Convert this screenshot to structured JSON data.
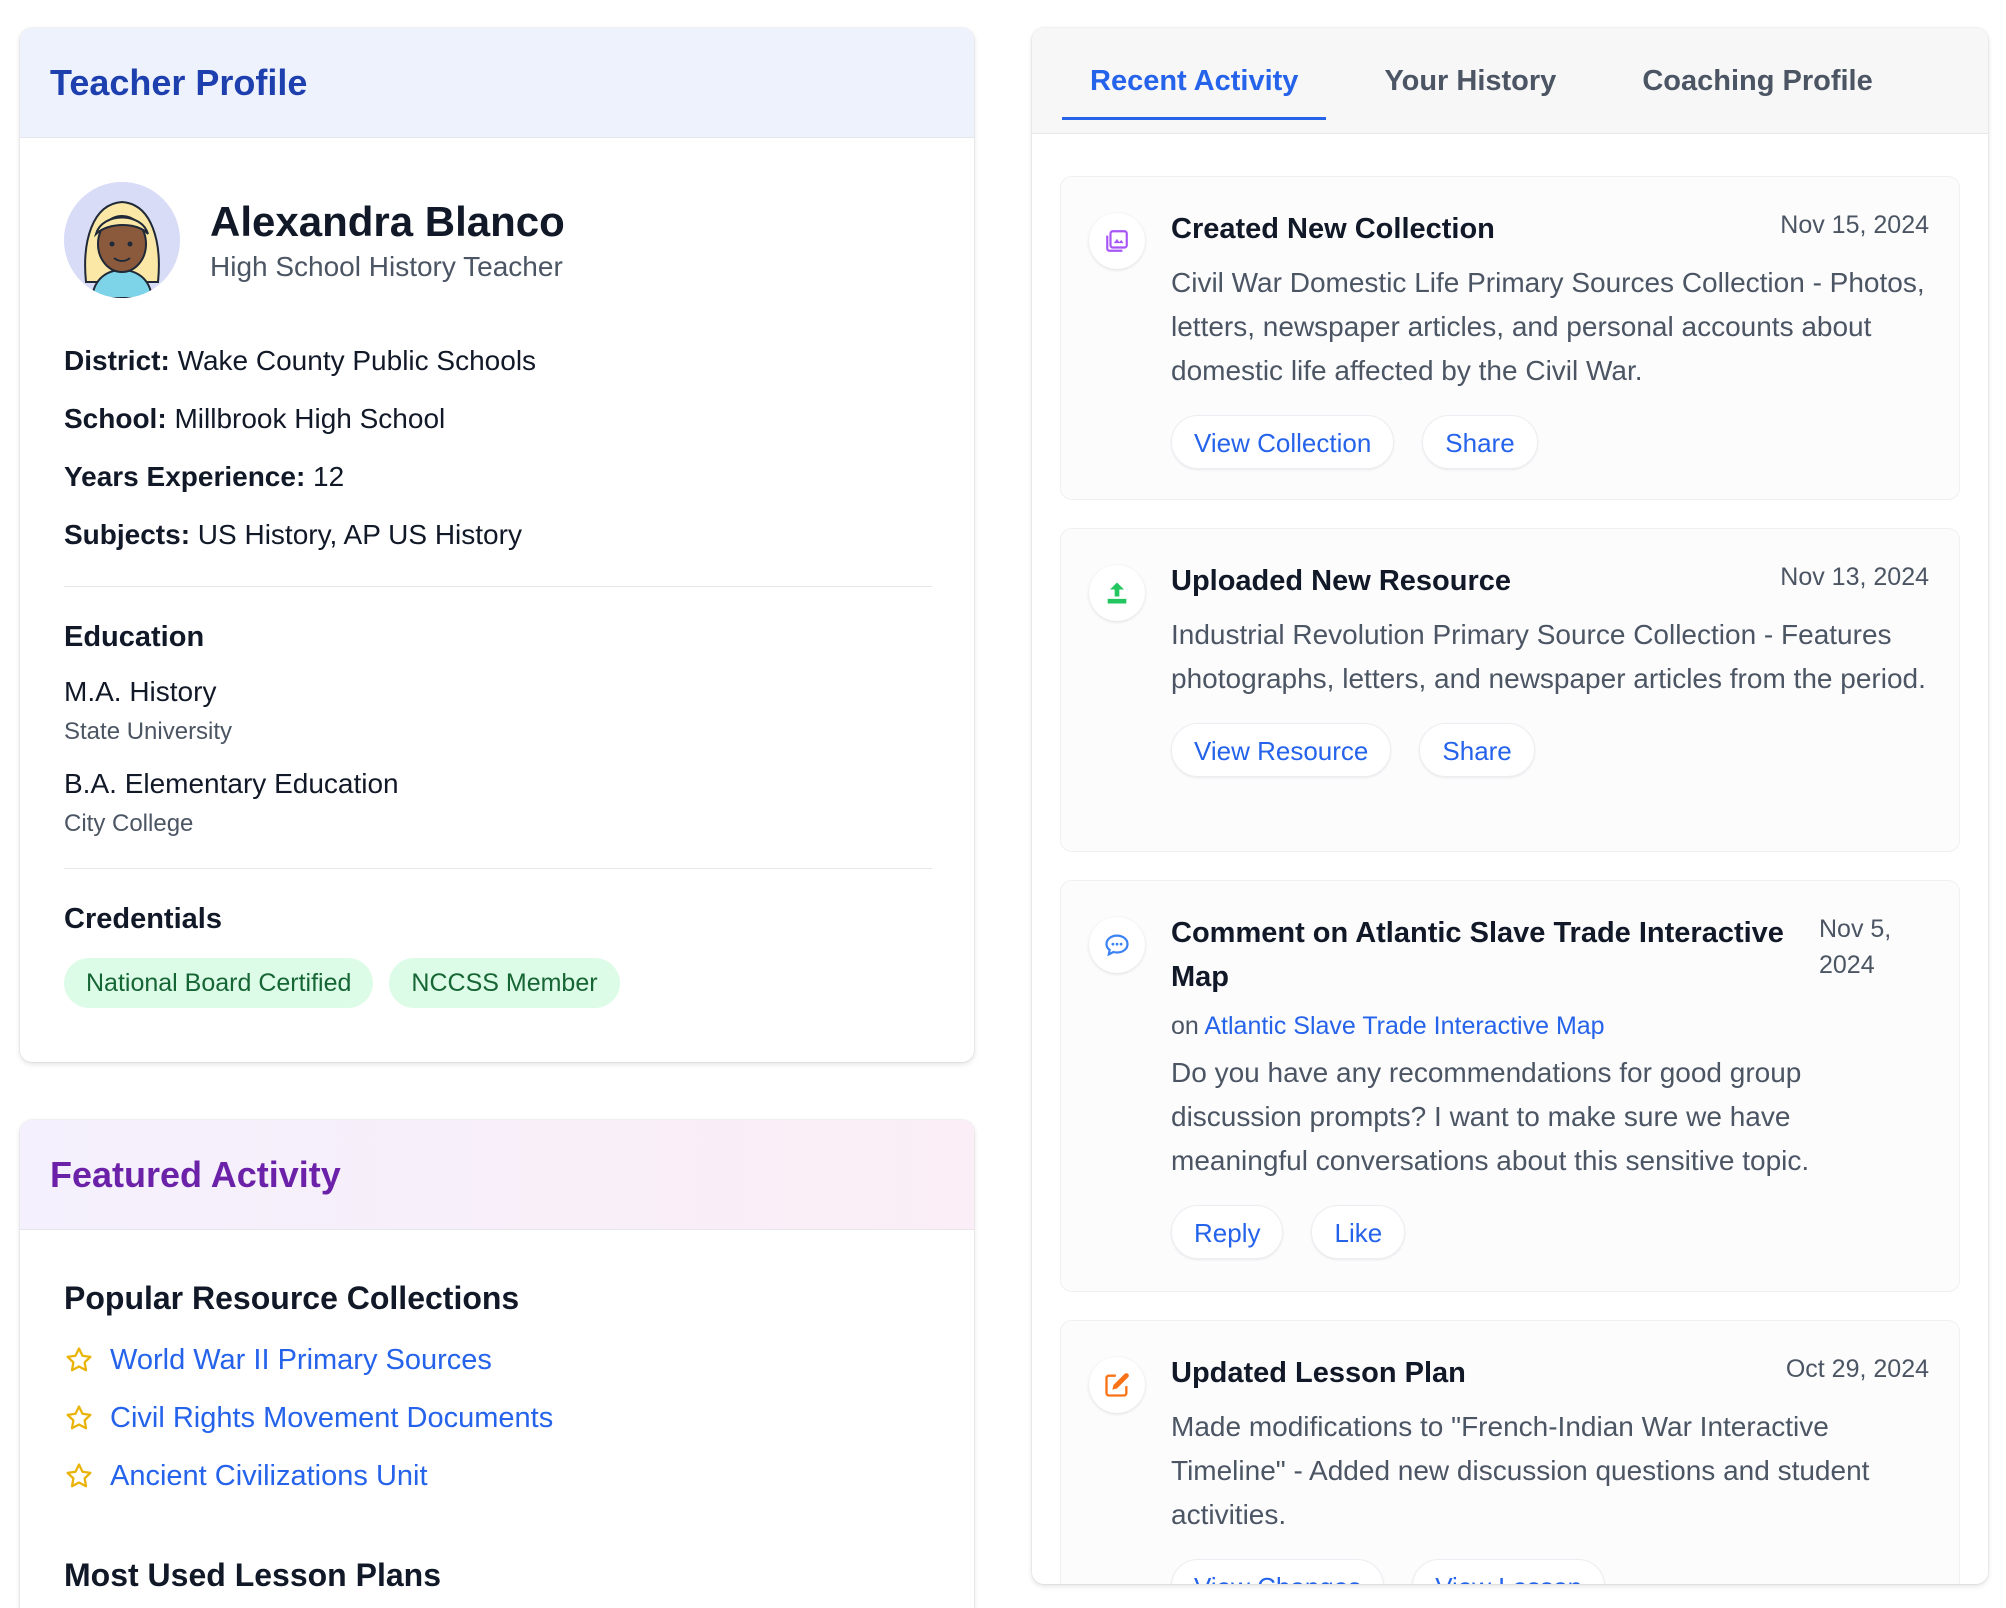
{
  "profile": {
    "header": "Teacher Profile",
    "name": "Alexandra Blanco",
    "role": "High School History Teacher",
    "facts": [
      {
        "label": "District:",
        "value": " Wake County Public Schools"
      },
      {
        "label": "School:",
        "value": " Millbrook High School"
      },
      {
        "label": "Years Experience:",
        "value": " 12"
      },
      {
        "label": "Subjects:",
        "value": " US History, AP US History"
      }
    ],
    "education_title": "Education",
    "education": [
      {
        "degree": "M.A. History",
        "school": "State University"
      },
      {
        "degree": "B.A. Elementary Education",
        "school": "City College"
      }
    ],
    "credentials_title": "Credentials",
    "credentials": [
      "National Board Certified",
      "NCCSS Member"
    ]
  },
  "featured": {
    "header": "Featured Activity",
    "collections_title": "Popular Resource Collections",
    "collections": [
      "World War II Primary Sources",
      "Civil Rights Movement Documents",
      "Ancient Civilizations Unit"
    ],
    "lessons_title": "Most Used Lesson Plans"
  },
  "tabs": [
    "Recent Activity",
    "Your History",
    "Coaching Profile"
  ],
  "activity": [
    {
      "icon": "collection-icon",
      "title": "Created New Collection",
      "date": "Nov 15, 2024",
      "description": "Civil War Domestic Life Primary Sources Collection - Photos, letters, newspaper articles, and personal accounts about domestic life affected by the Civil War.",
      "actions": [
        "View Collection",
        "Share"
      ]
    },
    {
      "icon": "upload-icon",
      "title": "Uploaded New Resource",
      "date": "Nov 13, 2024",
      "description": "Industrial Revolution Primary Source Collection - Features photographs, letters, and newspaper articles from the period.",
      "actions": [
        "View Resource",
        "Share"
      ]
    },
    {
      "icon": "comment-icon",
      "title": "Comment on Atlantic Slave Trade Interactive Map",
      "date": "Nov 5, 2024",
      "on_prefix": "on ",
      "on_link": "Atlantic Slave Trade Interactive Map",
      "description": "Do you have any recommendations for good group discussion prompts? I want to make sure we have meaningful conversations about this sensitive topic.",
      "actions": [
        "Reply",
        "Like"
      ]
    },
    {
      "icon": "edit-icon",
      "title": "Updated Lesson Plan",
      "date": "Oct 29, 2024",
      "description": "Made modifications to \"French-Indian War Interactive Timeline\" - Added new discussion questions and student activities.",
      "actions": [
        "View Changes",
        "View Lesson"
      ]
    }
  ],
  "colors": {
    "accent": "#2563eb",
    "profile_header": "#1e40af",
    "featured_header": "#6b21a8",
    "badge_bg": "#dcfce7",
    "badge_text": "#166534",
    "collection_icon": "#a855f7",
    "upload_icon": "#22c55e",
    "comment_icon": "#3b82f6",
    "edit_icon": "#f97316",
    "star_icon": "#eab308"
  }
}
